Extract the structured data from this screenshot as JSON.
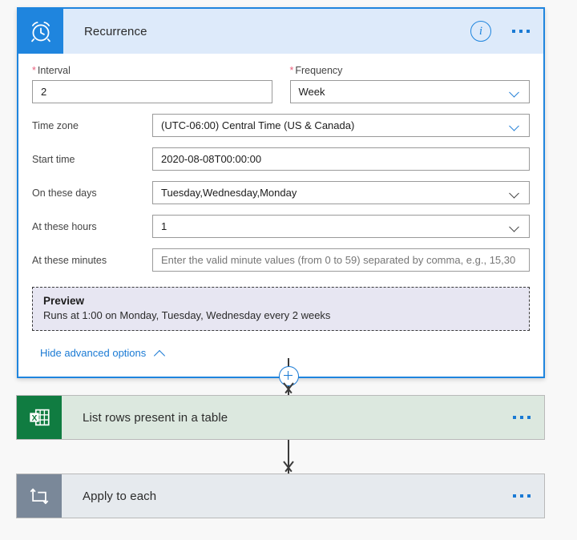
{
  "recurrence": {
    "icon": "alarm-clock-icon",
    "title": "Recurrence",
    "info_icon": "info-icon",
    "menu_icon": "ellipsis-menu-icon",
    "interval": {
      "required_marker": "*",
      "label": "Interval",
      "value": "2"
    },
    "frequency": {
      "required_marker": "*",
      "label": "Frequency",
      "value": "Week",
      "chevron": "chevron-down-icon"
    },
    "timezone": {
      "label": "Time zone",
      "value": "(UTC-06:00) Central Time (US & Canada)",
      "chevron": "chevron-down-icon"
    },
    "start_time": {
      "label": "Start time",
      "value": "2020-08-08T00:00:00"
    },
    "on_these_days": {
      "label": "On these days",
      "value": "Tuesday,Wednesday,Monday",
      "chevron": "chevron-down-icon"
    },
    "at_these_hours": {
      "label": "At these hours",
      "value": "1",
      "chevron": "chevron-down-icon"
    },
    "at_these_minutes": {
      "label": "At these minutes",
      "value": "",
      "placeholder": "Enter the valid minute values (from 0 to 59) separated by comma, e.g., 15,30"
    },
    "preview": {
      "title": "Preview",
      "text": "Runs at 1:00 on Monday, Tuesday, Wednesday every 2 weeks"
    },
    "advanced_options": {
      "label": "Hide advanced options",
      "chevron": "chevron-up-icon"
    }
  },
  "connectors": {
    "add_step_icon": "plus-circle-icon",
    "arrow_icon": "arrow-down-icon"
  },
  "actions": [
    {
      "icon": "excel-icon",
      "title": "List rows present in a table",
      "menu_icon": "ellipsis-menu-icon"
    },
    {
      "icon": "apply-to-each-loop-icon",
      "title": "Apply to each",
      "menu_icon": "ellipsis-menu-icon"
    }
  ],
  "colors": {
    "accent_blue": "#1f85de",
    "link_blue": "#1a7ad4",
    "header_blue": "#ddeafa",
    "required_red": "#e8607d",
    "excel_green": "#107c41",
    "excel_card_bg": "#dce8df",
    "foreach_gray": "#7a8899",
    "foreach_card_bg": "#e6eaee",
    "preview_bg": "#e7e6f2"
  }
}
